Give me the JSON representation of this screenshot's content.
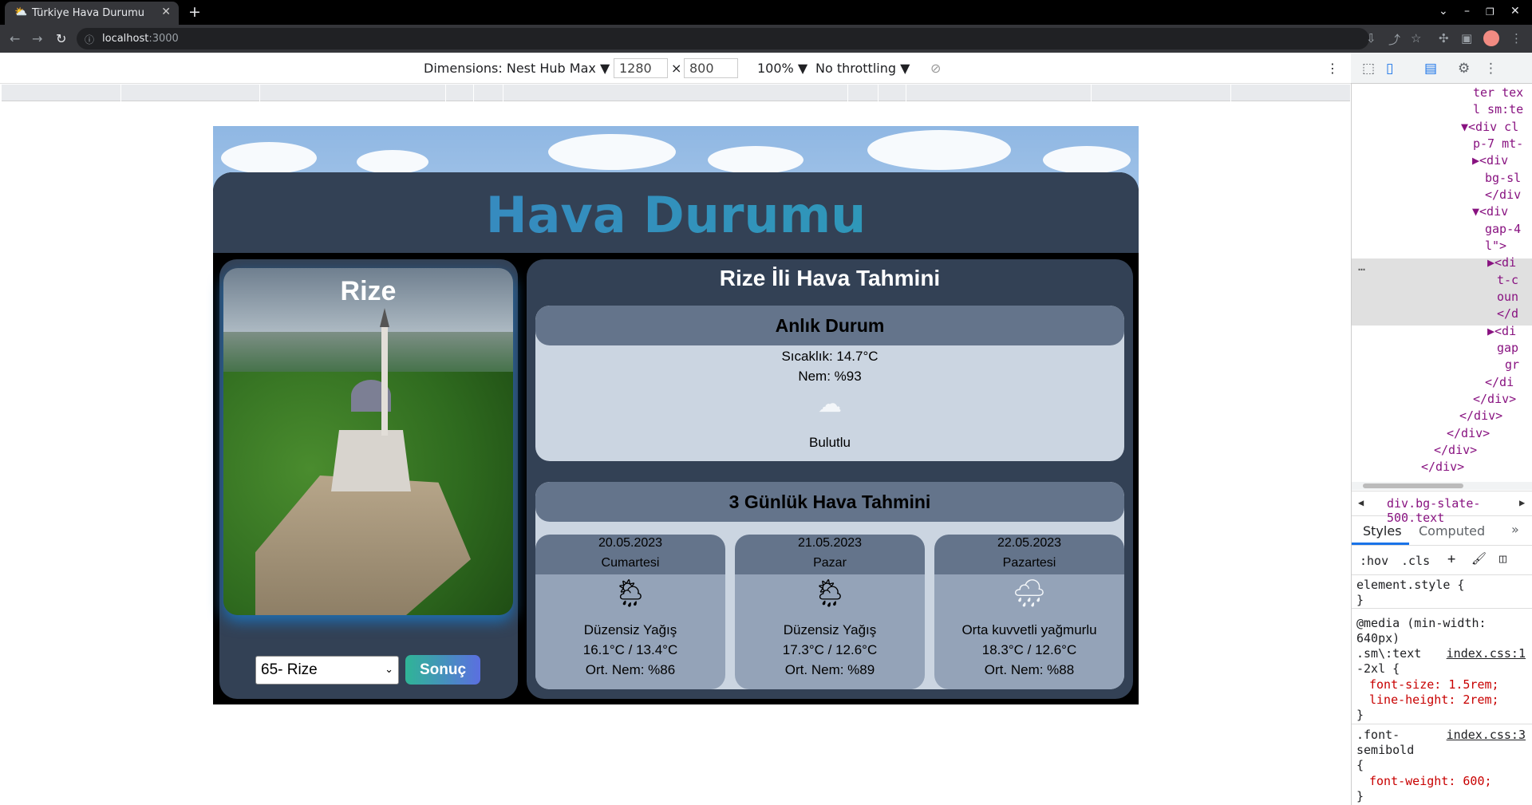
{
  "browser": {
    "tab_title": "Türkiye Hava Durumu",
    "url_host": "localhost",
    "url_port": ":3000"
  },
  "device_toolbar": {
    "dimensions_label": "Dimensions: Nest Hub Max",
    "width": "1280",
    "times": "×",
    "height": "800",
    "zoom": "100%",
    "throttling": "No throttling"
  },
  "devtools": {
    "elements_lines": [
      "ter tex",
      "l sm:te",
      "▼<div cl",
      "p-7 mt-",
      "▶<div ",
      "bg-sl",
      "</div",
      "▼<div ",
      "gap-4",
      "l\">",
      "▶<di",
      "t-c",
      "oun",
      "</d",
      "▶<di",
      "gap",
      "gr",
      "</di",
      "</div>",
      "</div>",
      "</div>",
      "</div>",
      "</div>"
    ],
    "breadcrumb": "div.bg-slate-500.text",
    "tabs": [
      "Styles",
      "Computed"
    ],
    "filter": [
      ":hov",
      ".cls"
    ],
    "styles": {
      "element_style": "element.style {",
      "media": "@media (min-width:",
      "media2": "640px)",
      "rule1_selector": ".sm\\:text",
      "rule1_selector2": "-2xl {",
      "rule1_src": "index.css:1",
      "rule1_p1": "font-size: 1.5rem;",
      "rule1_p2": "line-height: 2rem;",
      "rule2_selector": ".font-",
      "rule2_selector2": "semibold",
      "rule2_src": "index.css:3",
      "rule2_p1": "font-weight: 600;",
      "close": "}",
      "open": "{"
    }
  },
  "app": {
    "title": "Hava Durumu",
    "city": "Rize",
    "select_value": "65- Rize",
    "button": "Sonuç",
    "forecast_title": "Rize İli Hava Tahmini",
    "current": {
      "heading": "Anlık Durum",
      "temp": "Sıcaklık: 14.7°C",
      "humidity": "Nem: %93",
      "icon": "cloud-icon",
      "condition": "Bulutlu"
    },
    "three_day": {
      "heading": "3 Günlük Hava Tahmini",
      "days": [
        {
          "date": "20.05.2023",
          "day": "Cumartesi",
          "icon": "sun-cloud-rain-icon",
          "condition": "Düzensiz Yağış",
          "temps": "16.1°C / 13.4°C",
          "humidity": "Ort. Nem: %86"
        },
        {
          "date": "21.05.2023",
          "day": "Pazar",
          "icon": "sun-cloud-rain-icon",
          "condition": "Düzensiz Yağış",
          "temps": "17.3°C / 12.6°C",
          "humidity": "Ort. Nem: %89"
        },
        {
          "date": "22.05.2023",
          "day": "Pazartesi",
          "icon": "cloud-rain-icon",
          "condition": "Orta kuvvetli yağmurlu",
          "temps": "18.3°C / 12.6°C",
          "humidity": "Ort. Nem: %88"
        }
      ]
    }
  }
}
